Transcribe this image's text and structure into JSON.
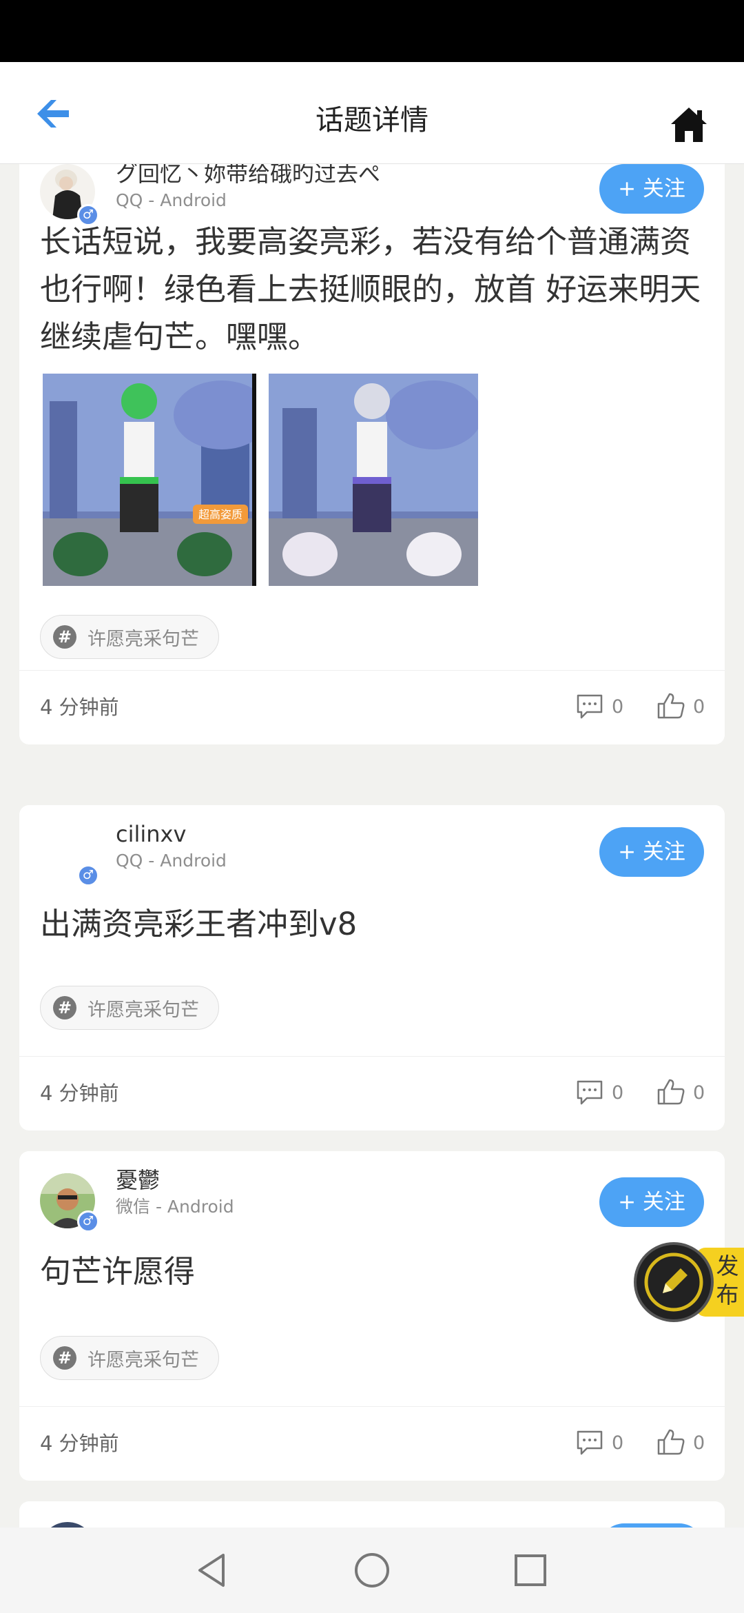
{
  "header": {
    "title": "话题详情"
  },
  "icons": {
    "back": "arrow-left-icon",
    "home": "house-icon",
    "comment": "speech-bubble-icon",
    "like": "thumbs-up-icon",
    "publish": "pencil-icon"
  },
  "colors": {
    "accent": "#4da3f5",
    "gender": "#5a8ee6",
    "publish": "#f5d020"
  },
  "posts": [
    {
      "username": "グ回忆丶妳带给硪旳过去ぺ",
      "platform": "QQ - Android",
      "gender": "♂",
      "follow_label": "+ 关注",
      "content": "长话短说，我要高姿亮彩，若没有给个普通满资也行啊！绿色看上去挺顺眼的，放首 好运来明天继续虐句芒。嘿嘿。",
      "tag": "许愿亮采句芒",
      "tag_hash": "#",
      "time": "4 分钟前",
      "comments": "0",
      "likes": "0",
      "image_badge": "超高姿质"
    },
    {
      "username": "cilinxv",
      "platform": "QQ - Android",
      "gender": "♂",
      "follow_label": "+ 关注",
      "content": "出满资亮彩王者冲到v8",
      "tag": "许愿亮采句芒",
      "tag_hash": "#",
      "time": "4 分钟前",
      "comments": "0",
      "likes": "0"
    },
    {
      "username": "憂鬱",
      "platform": "微信 - Android",
      "gender": "♂",
      "follow_label": "+ 关注",
      "content": "句芒许愿得",
      "tag": "许愿亮采句芒",
      "tag_hash": "#",
      "time": "4 分钟前",
      "comments": "0",
      "likes": "0"
    }
  ],
  "publish": {
    "label": "发布"
  },
  "nav": {
    "back": "triangle-back-icon",
    "home": "circle-home-icon",
    "recents": "square-recents-icon"
  }
}
